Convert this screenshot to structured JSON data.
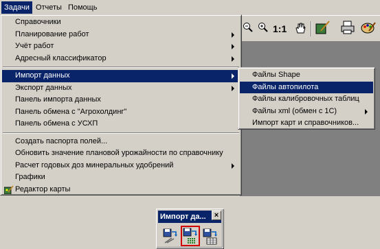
{
  "menubar": {
    "items": [
      {
        "label": "Задачи",
        "active": true
      },
      {
        "label": "Отчеты",
        "active": false
      },
      {
        "label": "Помощь",
        "active": false
      }
    ]
  },
  "toolbar": {
    "zoom_text": "1:1"
  },
  "main_menu": {
    "group1": [
      {
        "label": "Справочники",
        "submenu": false
      },
      {
        "label": "Планирование работ",
        "submenu": true
      },
      {
        "label": "Учёт работ",
        "submenu": true
      },
      {
        "label": "Адресный классификатор",
        "submenu": true
      }
    ],
    "group2": [
      {
        "label": "Импорт данных",
        "submenu": true,
        "highlighted": true
      },
      {
        "label": "Экспорт данных",
        "submenu": true
      },
      {
        "label": "Панель импорта данных",
        "submenu": false
      },
      {
        "label": "Панель обмена с \"Агрохолдинг\"",
        "submenu": false
      },
      {
        "label": "Панель обмена с УСХП",
        "submenu": false
      }
    ],
    "group3": [
      {
        "label": "Создать паспорта полей...",
        "submenu": false
      },
      {
        "label": "Обновить значение плановой урожайности по справочнику",
        "submenu": false
      },
      {
        "label": "Расчет годовых доз минеральных удобрений",
        "submenu": true
      },
      {
        "label": "Графики",
        "submenu": false
      },
      {
        "label": "Редактор карты",
        "submenu": false,
        "icon": "map-editor-icon"
      }
    ]
  },
  "sub_menu": {
    "items": [
      {
        "label": "Файлы Shape",
        "submenu": false
      },
      {
        "label": "Файлы автопилота",
        "submenu": false,
        "highlighted": true
      },
      {
        "label": "Файлы калибровочных таблиц",
        "submenu": false
      },
      {
        "label": "Файлы xml (обмен с 1С)",
        "submenu": true
      },
      {
        "label": "Импорт карт и справочников...",
        "submenu": false
      }
    ]
  },
  "float_toolbar": {
    "title": "Импорт да...",
    "close": "×",
    "buttons": [
      "import-shape-icon",
      "import-autopilot-icon",
      "import-calibration-icon"
    ]
  }
}
